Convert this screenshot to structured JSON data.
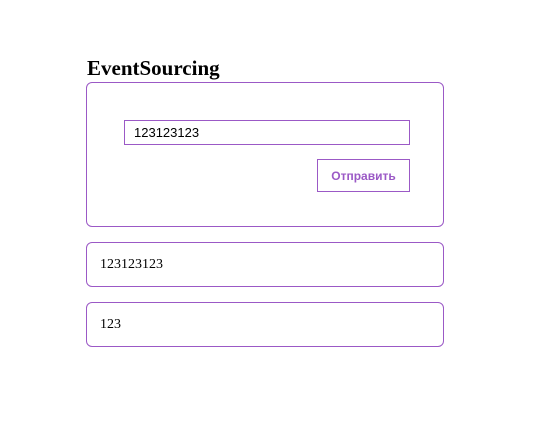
{
  "header": {
    "title": "EventSourcing"
  },
  "form": {
    "input_value": "123123123",
    "submit_label": "Отправить"
  },
  "events": [
    {
      "text": "123123123"
    },
    {
      "text": "123"
    }
  ],
  "colors": {
    "accent": "#9b59c6",
    "text": "#000000",
    "background": "#ffffff"
  }
}
